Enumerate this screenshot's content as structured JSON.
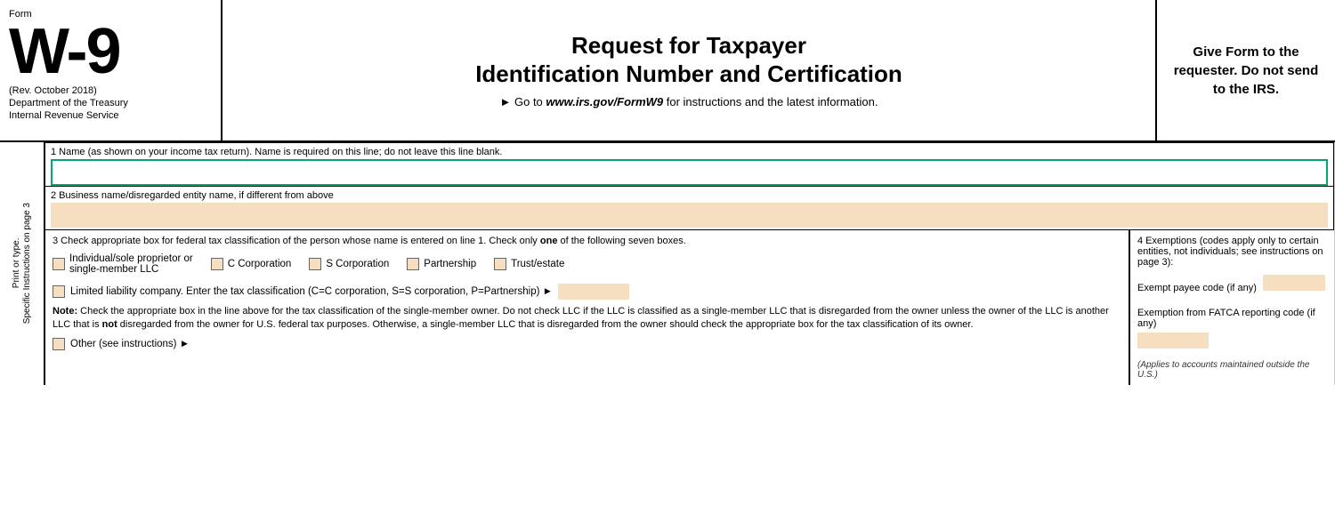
{
  "header": {
    "form_label": "Form",
    "form_number": "W-9",
    "rev": "(Rev. October 2018)",
    "dept1": "Department of the Treasury",
    "dept2": "Internal Revenue Service",
    "title_line1": "Request for Taxpayer",
    "title_line2": "Identification Number and Certification",
    "instruction": "► Go to",
    "url": "www.irs.gov/FormW9",
    "instruction2": "for instructions and the latest information.",
    "right_text": "Give Form to the requester. Do not send to the IRS."
  },
  "side": {
    "label": "Print or type.    Specific Instructions on page 3"
  },
  "field1": {
    "label": "1  Name (as shown on your income tax return). Name is required on this line; do not leave this line blank."
  },
  "field2": {
    "label": "2  Business name/disregarded entity name, if different from above"
  },
  "field3": {
    "label_start": "3  Check appropriate box for federal tax classification of the person whose name is entered on line 1. Check only ",
    "label_bold": "one",
    "label_end": " of the following seven boxes.",
    "checkboxes": [
      {
        "id": "indiv",
        "label": "Individual/sole proprietor or\nsingle-member LLC"
      },
      {
        "id": "ccorp",
        "label": "C Corporation"
      },
      {
        "id": "scorp",
        "label": "S Corporation"
      },
      {
        "id": "partner",
        "label": "Partnership"
      },
      {
        "id": "trust",
        "label": "Trust/estate"
      }
    ],
    "llc_label": "Limited liability company. Enter the tax classification (C=C corporation, S=S corporation, P=Partnership) ►",
    "note_bold": "Note:",
    "note_text": " Check the appropriate box in the line above for the tax classification of the single-member owner.  Do not check LLC if the LLC is classified as a single-member LLC that is disregarded from the owner unless the owner of the LLC is another LLC that is ",
    "note_not": "not",
    "note_text2": " disregarded from the owner for U.S. federal tax purposes. Otherwise, a single-member LLC that is disregarded from the owner should check the appropriate box for the tax classification of its owner.",
    "other_label": "Other (see instructions) ►"
  },
  "field4": {
    "title": "4  Exemptions (codes apply only to certain entities, not individuals; see instructions on page 3):",
    "exempt_label": "Exempt payee code (if any)",
    "fatca_label": "Exemption from FATCA reporting code (if any)",
    "applies": "(Applies to accounts maintained outside the U.S.)"
  }
}
